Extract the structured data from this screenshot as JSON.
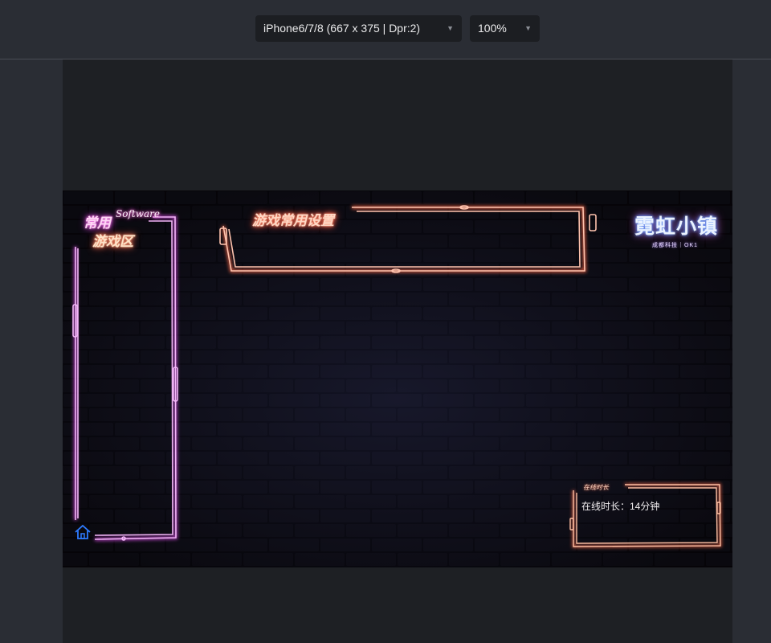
{
  "toolbar": {
    "device": "iPhone6/7/8 (667 x 375 | Dpr:2)",
    "zoom": "100%"
  },
  "game": {
    "side_panel": {
      "title_line1": "常用",
      "title_line2": "游戏区",
      "script_word": "Software"
    },
    "settings_panel": {
      "title": "游戏常用设置"
    },
    "logo": {
      "text": "霓虹小镇",
      "sub": "成都科技｜OK1"
    },
    "online_panel": {
      "tag": "在线时长",
      "text": "在线时长：14分钟"
    },
    "icons": {
      "home": "home-icon",
      "caret": "caret-down-icon"
    },
    "colors": {
      "neon_pink": "#e69cf0",
      "neon_orange": "#ffb6a0",
      "neon_blue": "#2e7bff",
      "wall": "#0d0b14"
    }
  }
}
